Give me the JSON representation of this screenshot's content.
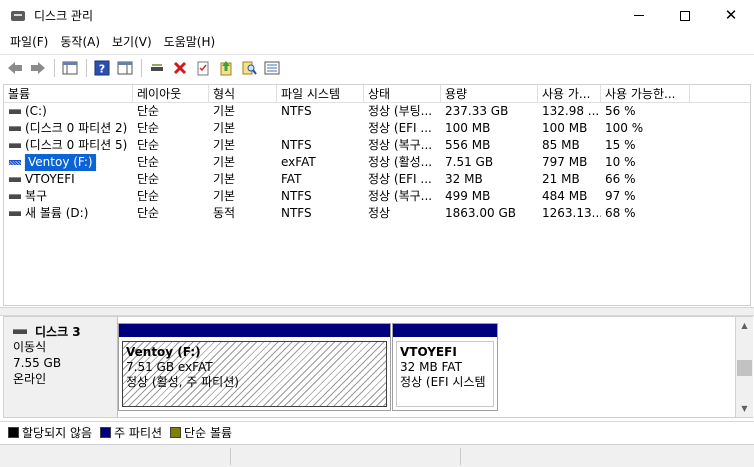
{
  "window": {
    "title": "디스크 관리",
    "controls": {
      "minimize": "",
      "maximize": "",
      "close": "✕"
    }
  },
  "menu": [
    {
      "label": "파일(F)"
    },
    {
      "label": "동작(A)"
    },
    {
      "label": "보기(V)"
    },
    {
      "label": "도움말(H)"
    }
  ],
  "toolbar": {
    "icons": [
      "back-arrow-icon",
      "forward-arrow-icon",
      "console-tree-icon",
      "help-icon",
      "action-pane-icon",
      "connect-disk-icon",
      "delete-icon",
      "properties-icon",
      "export-icon",
      "search-icon",
      "settings-list-icon"
    ]
  },
  "volume_table": {
    "columns": [
      "볼륨",
      "레이아웃",
      "형식",
      "파일 시스템",
      "상태",
      "용량",
      "사용 가...",
      "사용 가능한..."
    ],
    "rows": [
      {
        "volume": "(C:)",
        "layout": "단순",
        "type": "기본",
        "fs": "NTFS",
        "status": "정상 (부팅...",
        "capacity": "237.33 GB",
        "free": "132.98 ...",
        "pct": "56 %",
        "selected": false,
        "hatched": false
      },
      {
        "volume": "(디스크 0 파티션 2)",
        "layout": "단순",
        "type": "기본",
        "fs": "",
        "status": "정상 (EFI ...",
        "capacity": "100 MB",
        "free": "100 MB",
        "pct": "100 %",
        "selected": false,
        "hatched": false
      },
      {
        "volume": "(디스크 0 파티션 5)",
        "layout": "단순",
        "type": "기본",
        "fs": "NTFS",
        "status": "정상 (복구...",
        "capacity": "556 MB",
        "free": "85 MB",
        "pct": "15 %",
        "selected": false,
        "hatched": false
      },
      {
        "volume": "Ventoy (F:)",
        "layout": "단순",
        "type": "기본",
        "fs": "exFAT",
        "status": "정상 (활성...",
        "capacity": "7.51 GB",
        "free": "797 MB",
        "pct": "10 %",
        "selected": true,
        "hatched": true
      },
      {
        "volume": "VTOYEFI",
        "layout": "단순",
        "type": "기본",
        "fs": "FAT",
        "status": "정상 (EFI ...",
        "capacity": "32 MB",
        "free": "21 MB",
        "pct": "66 %",
        "selected": false,
        "hatched": false
      },
      {
        "volume": "복구",
        "layout": "단순",
        "type": "기본",
        "fs": "NTFS",
        "status": "정상 (복구...",
        "capacity": "499 MB",
        "free": "484 MB",
        "pct": "97 %",
        "selected": false,
        "hatched": false
      },
      {
        "volume": "새 볼륨 (D:)",
        "layout": "단순",
        "type": "동적",
        "fs": "NTFS",
        "status": "정상",
        "capacity": "1863.00 GB",
        "free": "1263.13...",
        "pct": "68 %",
        "selected": false,
        "hatched": false
      }
    ]
  },
  "disk": {
    "name": "디스크 3",
    "media": "이동식",
    "size": "7.55 GB",
    "state": "온라인",
    "partitions": [
      {
        "name": "Ventoy  (F:)",
        "size_fs": "7.51 GB exFAT",
        "status": "정상 (활성, 주 파티션)"
      },
      {
        "name": "VTOYEFI",
        "size_fs": "32 MB FAT",
        "status": "정상 (EFI 시스템"
      }
    ]
  },
  "legend": [
    {
      "label": "할당되지 않음",
      "color": "#000000"
    },
    {
      "label": "주 파티션",
      "color": "#00007f"
    },
    {
      "label": "단순 볼륨",
      "color": "#808000"
    }
  ],
  "colors": {
    "primary_partition": "#00007f",
    "selection": "#0a64d6"
  }
}
